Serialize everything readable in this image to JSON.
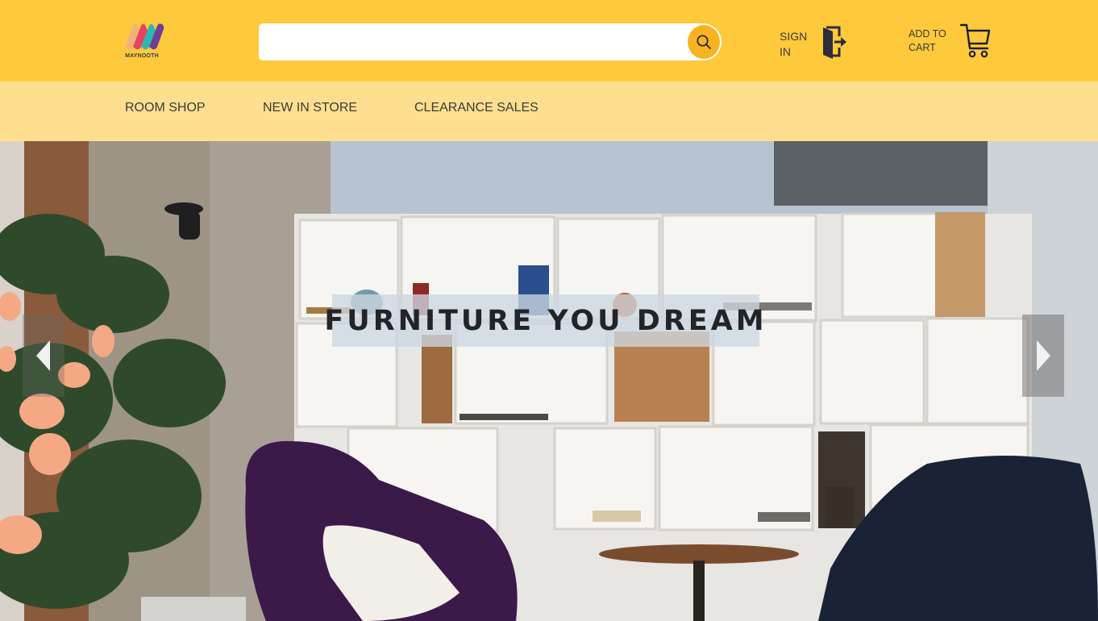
{
  "header": {
    "logo_text": "MAYNOOTH",
    "search": {
      "value": "",
      "placeholder": ""
    },
    "sign_in_label": "SIGN IN",
    "cart_label": "ADD TO CART"
  },
  "nav": {
    "items": [
      {
        "label": "ROOM SHOP"
      },
      {
        "label": "NEW IN STORE"
      },
      {
        "label": "CLEARANCE SALES"
      }
    ]
  },
  "hero": {
    "title": "FURNITURE YOU DREAM"
  },
  "icons": {
    "search": "search-icon",
    "sign_in": "door-exit-icon",
    "cart": "cart-icon",
    "prev": "arrow-left-icon",
    "next": "arrow-right-icon"
  },
  "colors": {
    "header_bg": "#ffc93c",
    "nav_bg": "#fedf8f",
    "search_button": "#f7b320",
    "text": "#3a3a3a"
  }
}
